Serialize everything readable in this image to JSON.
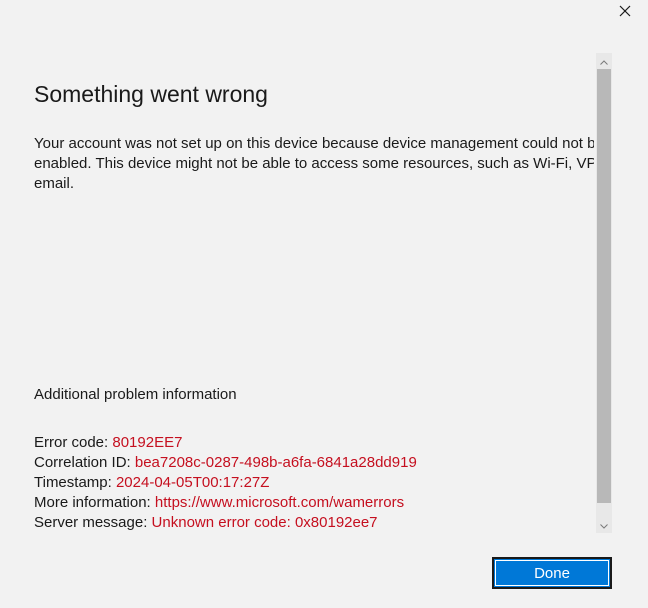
{
  "window": {
    "close_icon": "close-icon"
  },
  "heading": "Something went wrong",
  "message": "Your account was not set up on this device because device management could not be enabled. This device might not be able to access some resources, such as Wi-Fi, VPN, or email.",
  "additional_heading": "Additional problem information",
  "details": [
    {
      "label": "Error code: ",
      "value": "80192EE7"
    },
    {
      "label": "Correlation ID: ",
      "value": "bea7208c-0287-498b-a6fa-6841a28dd919"
    },
    {
      "label": "Timestamp: ",
      "value": "2024-04-05T00:17:27Z"
    },
    {
      "label": "More information: ",
      "value": "https://www.microsoft.com/wamerrors"
    },
    {
      "label": "Server message: ",
      "value": "Unknown error code: 0x80192ee7"
    }
  ],
  "buttons": {
    "done_label": "Done"
  },
  "colors": {
    "accent": "#0078d7",
    "error_text": "#c50f1f",
    "background": "#f2f2f2"
  }
}
